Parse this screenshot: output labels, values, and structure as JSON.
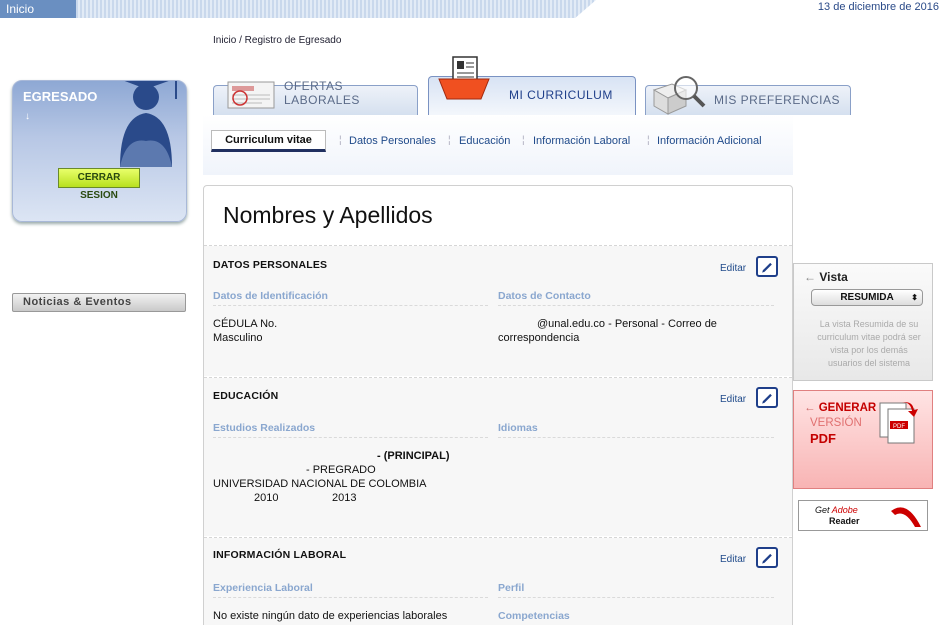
{
  "topbar": {
    "home_label": "Inicio",
    "date": "13 de diciembre de 2016"
  },
  "breadcrumb": "Inicio / Registro de Egresado",
  "user_card": {
    "title": "EGRESADO",
    "arrow": "↓",
    "logout_label": "CERRAR SESION"
  },
  "news_label": "Noticias & Eventos",
  "tabs": [
    {
      "label": "OFERTAS LABORALES",
      "icon": "job-offers-icon"
    },
    {
      "label": "MI CURRICULUM",
      "icon": "resume-folder-icon"
    },
    {
      "label": "MIS PREFERENCIAS",
      "icon": "magnifier-cube-icon"
    }
  ],
  "subtabs": [
    "Curriculum vitae",
    "Datos Personales",
    "Educación",
    "Información Laboral",
    "Información Adicional"
  ],
  "profile": {
    "name": "Nombres y Apellidos"
  },
  "edit_label": "Editar",
  "personal": {
    "title": "DATOS PERSONALES",
    "id_header": "Datos de Identificación",
    "contact_header": "Datos de Contacto",
    "id_line1": "CÉDULA No.",
    "id_line2": "Masculino",
    "contact_line1": "@unal.edu.co - Personal - Correo de",
    "contact_line2": "correspondencia"
  },
  "education": {
    "title": "EDUCACIÓN",
    "studies_header": "Estudios Realizados",
    "languages_header": "Idiomas",
    "principal": "- (PRINCIPAL)",
    "level": "- PREGRADO",
    "university": "UNIVERSIDAD NACIONAL DE COLOMBIA",
    "year_start": "2010",
    "year_end": "2013"
  },
  "work": {
    "title": "INFORMACIÓN LABORAL",
    "experience_header": "Experiencia Laboral",
    "profile_header": "Perfil",
    "skills_header": "Competencias",
    "no_experience": "No existe ningún dato de experiencias laborales"
  },
  "vista": {
    "title": "Vista",
    "selected": "RESUMIDA",
    "help": "La vista Resumida de su curriculum vitae podrá ser vista por los demás usuarios del sistema"
  },
  "pdf": {
    "line1": "GENERAR",
    "line2": "VERSIÓN",
    "line3": "PDF"
  },
  "adobe": {
    "get": "Get",
    "brand": "Adobe",
    "product": "Reader"
  }
}
